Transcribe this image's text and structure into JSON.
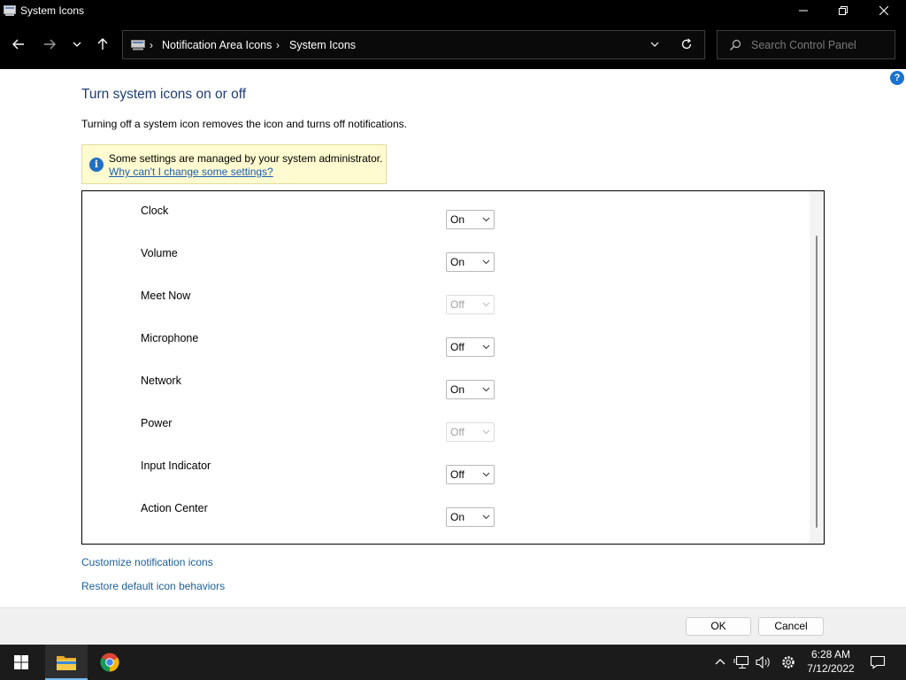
{
  "window": {
    "title": "System Icons"
  },
  "address": {
    "crumbs": [
      "Notification Area Icons",
      "System Icons"
    ]
  },
  "search": {
    "placeholder": "Search Control Panel"
  },
  "help_label": "?",
  "content": {
    "heading": "Turn system icons on or off",
    "description": "Turning off a system icon removes the icon and turns off notifications.",
    "notice": {
      "message": "Some settings are managed by your system administrator.",
      "link": "Why can't I change some settings?"
    }
  },
  "icons": [
    {
      "label": "Clock",
      "value": "On",
      "disabled": false
    },
    {
      "label": "Volume",
      "value": "On",
      "disabled": false
    },
    {
      "label": "Meet Now",
      "value": "Off",
      "disabled": true
    },
    {
      "label": "Microphone",
      "value": "Off",
      "disabled": false
    },
    {
      "label": "Network",
      "value": "On",
      "disabled": false
    },
    {
      "label": "Power",
      "value": "Off",
      "disabled": true
    },
    {
      "label": "Input Indicator",
      "value": "Off",
      "disabled": false
    },
    {
      "label": "Action Center",
      "value": "On",
      "disabled": false
    }
  ],
  "links": {
    "customize": "Customize notification icons",
    "restore": "Restore default icon behaviors"
  },
  "buttons": {
    "ok": "OK",
    "cancel": "Cancel"
  },
  "taskbar": {
    "time": "6:28 AM",
    "date": "7/12/2022",
    "pinned": [
      "windows-start-icon",
      "file-explorer-icon",
      "chrome-icon"
    ],
    "tray": [
      "chevron-up-icon",
      "network-icon",
      "volume-icon",
      "settings-icon",
      "notification-icon"
    ]
  },
  "colors": {
    "heading": "#1e3c78",
    "link": "#1a5f9e",
    "notice_bg": "#fffbd0",
    "titlebar": "#000000"
  }
}
